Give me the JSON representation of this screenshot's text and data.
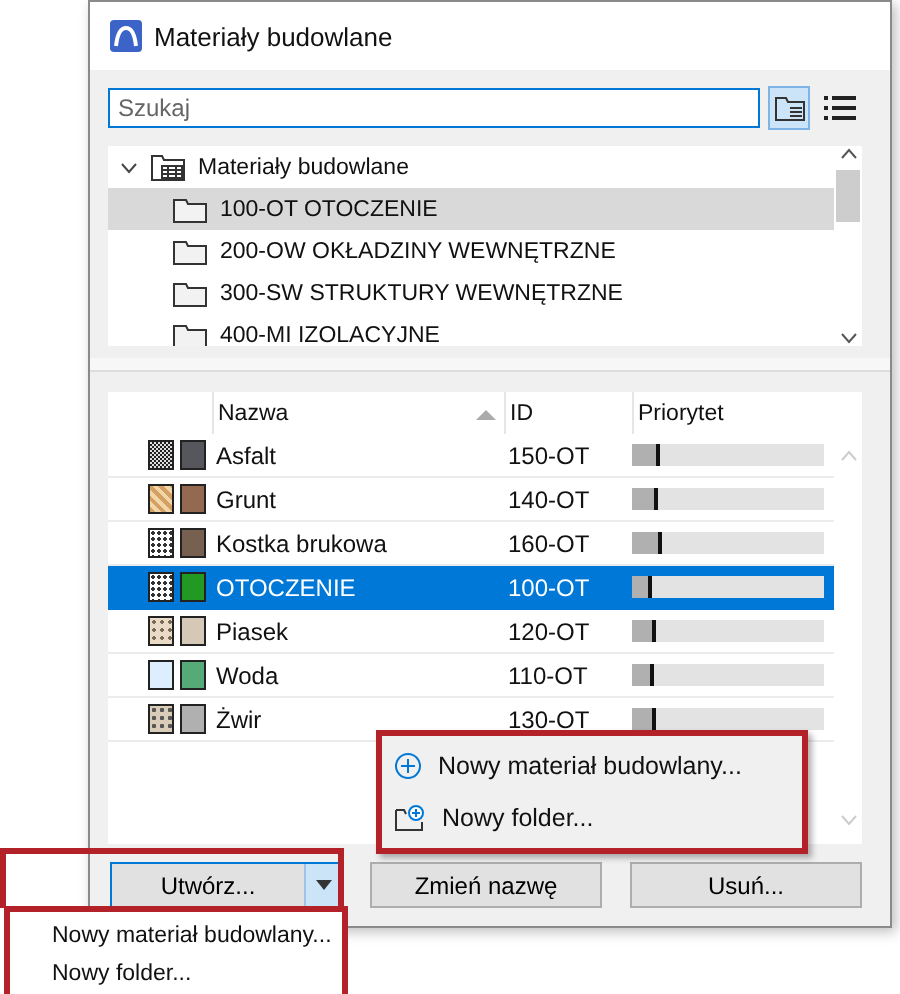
{
  "window": {
    "title": "Materiały budowlane"
  },
  "search": {
    "placeholder": "Szukaj"
  },
  "view_buttons": [
    {
      "kind": "tree",
      "selected": true
    },
    {
      "kind": "list",
      "selected": false
    }
  ],
  "tree": {
    "label": "Materiały budowlane",
    "expanded": true,
    "children": [
      {
        "label": "100-OT OTOCZENIE",
        "selected": true
      },
      {
        "label": "200-OW OKŁADZINY WEWNĘTRZNE",
        "selected": false
      },
      {
        "label": "300-SW STRUKTURY WEWNĘTRZNE",
        "selected": false
      },
      {
        "label": "400-MI IZOLACYJNE",
        "selected": false
      }
    ]
  },
  "table": {
    "columns": [
      "Nazwa",
      "ID",
      "Priorytet"
    ],
    "rows": [
      {
        "kind": "dense",
        "color": "#55575c",
        "name": "Asfalt",
        "id": "150-OT",
        "level": 0.15,
        "selected": false
      },
      {
        "kind": "hatch",
        "color": "#936a4f",
        "name": "Grunt",
        "id": "140-OT",
        "level": 0.14,
        "selected": false
      },
      {
        "kind": "dots",
        "color": "#77604f",
        "name": "Kostka brukowa",
        "id": "160-OT",
        "level": 0.16,
        "selected": false
      },
      {
        "kind": "dots",
        "color": "#229922",
        "name": "OTOCZENIE",
        "id": "100-OT",
        "level": 0.1,
        "selected": true
      },
      {
        "kind": "sparse",
        "color": "#d6c8b6",
        "name": "Piasek",
        "id": "120-OT",
        "level": 0.12,
        "selected": false
      },
      {
        "kind": "blank",
        "color": "#55aa77",
        "name": "Woda",
        "id": "110-OT",
        "level": 0.11,
        "selected": false
      },
      {
        "kind": "gravel",
        "color": "#b0b0b0",
        "name": "Żwir",
        "id": "130-OT",
        "level": 0.13,
        "selected": false
      }
    ]
  },
  "context_menu": [
    {
      "kind": "material",
      "label": "Nowy materiał budowlany..."
    },
    {
      "kind": "folder",
      "label": "Nowy folder..."
    }
  ],
  "buttons": [
    {
      "kind": "split",
      "label": "Utwórz..."
    },
    {
      "kind": "plain",
      "label": "Zmień nazwę"
    },
    {
      "kind": "plain",
      "label": "Usuń..."
    }
  ],
  "dropdown_menu": [
    "Nowy materiał budowlany...",
    "Nowy folder..."
  ]
}
